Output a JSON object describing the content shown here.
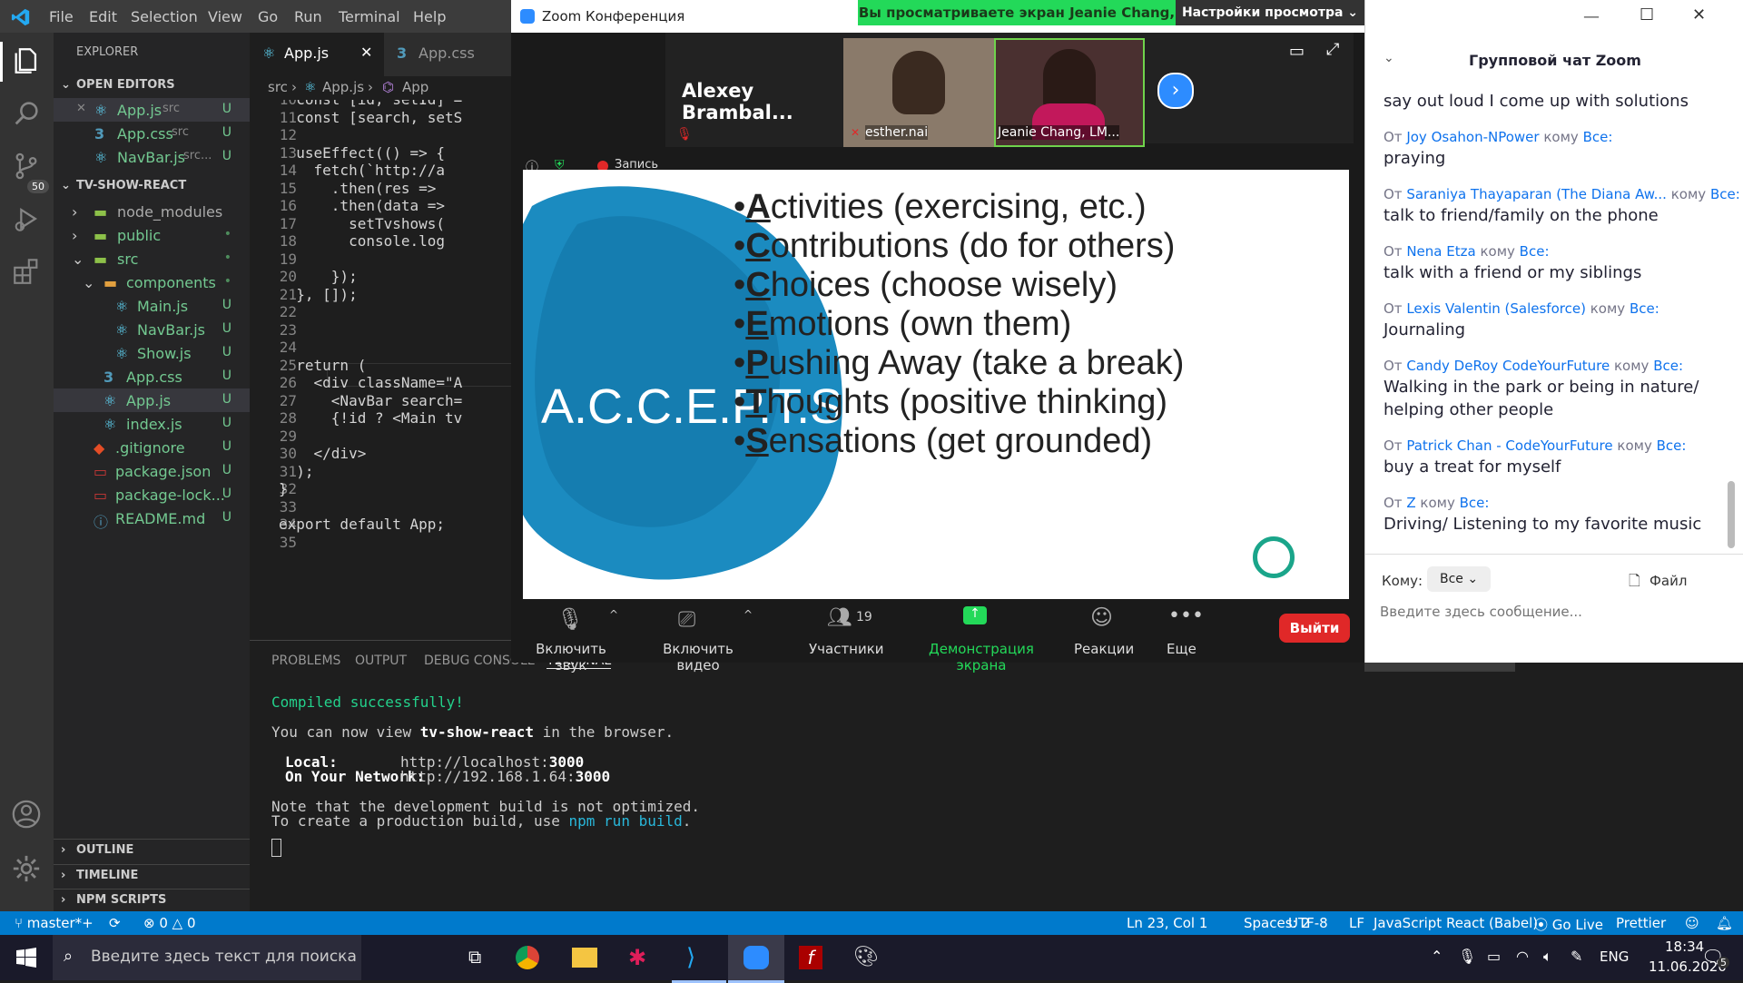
{
  "vscode": {
    "menu": [
      "File",
      "Edit",
      "Selection",
      "View",
      "Go",
      "Run",
      "Terminal",
      "Help"
    ],
    "explorer_title": "EXPLORER",
    "open_editors_title": "OPEN EDITORS",
    "open_editors": [
      {
        "name": "App.js",
        "path": "src",
        "status": "U"
      },
      {
        "name": "App.css",
        "path": "src",
        "status": "U"
      },
      {
        "name": "NavBar.js",
        "path": "src...",
        "status": "U"
      }
    ],
    "project_title": "TV-SHOW-REACT",
    "tree": [
      {
        "name": "node_modules",
        "status": ""
      },
      {
        "name": "public",
        "status": "•"
      },
      {
        "name": "src",
        "status": "•"
      },
      {
        "name": "components",
        "status": "•"
      },
      {
        "name": "Main.js",
        "status": "U"
      },
      {
        "name": "NavBar.js",
        "status": "U"
      },
      {
        "name": "Show.js",
        "status": "U"
      },
      {
        "name": "App.css",
        "status": "U"
      },
      {
        "name": "App.js",
        "status": "U"
      },
      {
        "name": "index.js",
        "status": "U"
      },
      {
        "name": ".gitignore",
        "status": "U"
      },
      {
        "name": "package.json",
        "status": "U"
      },
      {
        "name": "package-lock...",
        "status": "U"
      },
      {
        "name": "README.md",
        "status": "U"
      }
    ],
    "bottom_sections": [
      "OUTLINE",
      "TIMELINE",
      "NPM SCRIPTS"
    ],
    "scm_badge": "50",
    "tabs": [
      {
        "label": "App.js"
      },
      {
        "label": "App.css"
      }
    ],
    "breadcrumb": {
      "folder": "src",
      "file": "App.js",
      "symbol": "App"
    },
    "code_lines": [
      {
        "n": "10",
        "text": "  const [id, setId] = "
      },
      {
        "n": "11",
        "text": "  const [search, setS"
      },
      {
        "n": "12",
        "text": ""
      },
      {
        "n": "13",
        "text": "  useEffect(() => {"
      },
      {
        "n": "14",
        "text": "    fetch(`http://a"
      },
      {
        "n": "15",
        "text": "      .then(res => "
      },
      {
        "n": "16",
        "text": "      .then(data =>"
      },
      {
        "n": "17",
        "text": "        setTvshows("
      },
      {
        "n": "18",
        "text": "        console.log"
      },
      {
        "n": "19",
        "text": ""
      },
      {
        "n": "20",
        "text": "      });"
      },
      {
        "n": "21",
        "text": "  }, []);"
      },
      {
        "n": "22",
        "text": ""
      },
      {
        "n": "23",
        "text": ""
      },
      {
        "n": "24",
        "text": ""
      },
      {
        "n": "25",
        "text": "  return ("
      },
      {
        "n": "26",
        "text": "    <div className=\"A"
      },
      {
        "n": "27",
        "text": "      <NavBar search="
      },
      {
        "n": "28",
        "text": "      {!id ? <Main tv"
      },
      {
        "n": "29",
        "text": ""
      },
      {
        "n": "30",
        "text": "    </div>"
      },
      {
        "n": "31",
        "text": "  );"
      },
      {
        "n": "32",
        "text": "}"
      },
      {
        "n": "33",
        "text": ""
      },
      {
        "n": "34",
        "text": "export default App;"
      },
      {
        "n": "35",
        "text": ""
      }
    ],
    "panel_tabs": [
      "PROBLEMS",
      "OUTPUT",
      "DEBUG CONSOLE",
      "TERMINAL"
    ],
    "terminal_dropdown": "1: node",
    "terminal": {
      "line1": "Compiled successfully!",
      "line2_pre": "You can now view ",
      "line2_app": "tv-show-react",
      "line2_post": " in the browser.",
      "local_label": "Local:",
      "local_url": "http://localhost:",
      "local_port": "3000",
      "network_label": "On Your Network:",
      "network_url": "http://192.168.1.64:",
      "network_port": "3000",
      "note1": "Note that the development build is not optimized.",
      "note2_pre": "To create a production build, use ",
      "note2_cmd": "npm run build",
      "note2_post": "."
    },
    "status": {
      "branch": "master*+",
      "errors": "0",
      "warnings": "0",
      "position": "Ln 23, Col 1",
      "spaces": "Spaces: 2",
      "encoding": "UTF-8",
      "eol": "LF",
      "language": "JavaScript React (Babel)",
      "golive": "Go Live",
      "prettier": "Prettier",
      "notifications": "5"
    }
  },
  "zoom": {
    "window_title": "Zoom Конференция",
    "viewing_banner": "Вы просматриваете экран Jeanie Chang, LMFT",
    "view_options": "Настройки просмотра",
    "participants": [
      {
        "name": "Alexey Brambal..."
      },
      {
        "name": "esther.nai"
      },
      {
        "name": "Jeanie Chang, LM..."
      }
    ],
    "recording": "Запись",
    "slide": {
      "title": "A.C.C.E.P.T.S.",
      "bullets": [
        {
          "first": "A",
          "rest": "ctivities (exercising, etc.)"
        },
        {
          "first": "C",
          "rest": "ontributions (do for others)"
        },
        {
          "first": "C",
          "rest": "hoices (choose wisely)"
        },
        {
          "first": "E",
          "rest": "motions (own them)"
        },
        {
          "first": "P",
          "rest": "ushing Away (take a break)"
        },
        {
          "first": "T",
          "rest": "houghts (positive thinking)"
        },
        {
          "first": "S",
          "rest": "ensations (get grounded)"
        }
      ]
    },
    "toolbar": {
      "audio": "Включить звук",
      "video": "Включить видео",
      "participants": "Участники",
      "participants_count": "19",
      "share": "Демонстрация экрана",
      "reactions": "Реакции",
      "more": "Еще",
      "leave": "Выйти"
    },
    "chat": {
      "title": "Групповой чат Zoom",
      "first_msg": "say out loud I come up with solutions",
      "from_word": "От",
      "to_word": "кому",
      "everyone": "Все:",
      "messages": [
        {
          "from": "Joy Osahon-NPower",
          "text": [
            "praying"
          ]
        },
        {
          "from": "Saraniya Thayaparan (The Diana Aw...",
          "text": [
            "talk to friend/family on the phone"
          ]
        },
        {
          "from": "Nena Etza",
          "text": [
            "talk with a friend or my siblings"
          ]
        },
        {
          "from": "Lexis Valentin (Salesforce)",
          "text": [
            "Journaling"
          ]
        },
        {
          "from": "Candy DeRoy CodeYourFuture",
          "text": [
            "Walking in the park or being in nature/",
            "helping other people"
          ]
        },
        {
          "from": "Patrick Chan - CodeYourFuture",
          "text": [
            "buy a treat for myself"
          ]
        },
        {
          "from": "Z",
          "text": [
            "Driving/ Listening to my favorite music"
          ]
        }
      ],
      "to_label": "Кому:",
      "to_value": "Все",
      "file_label": "Файл",
      "input_placeholder": "Введите здесь сообщение..."
    }
  },
  "taskbar": {
    "search_placeholder": "Введите здесь текст для поиска",
    "lang": "ENG",
    "time": "18:34",
    "date": "11.06.2020"
  }
}
